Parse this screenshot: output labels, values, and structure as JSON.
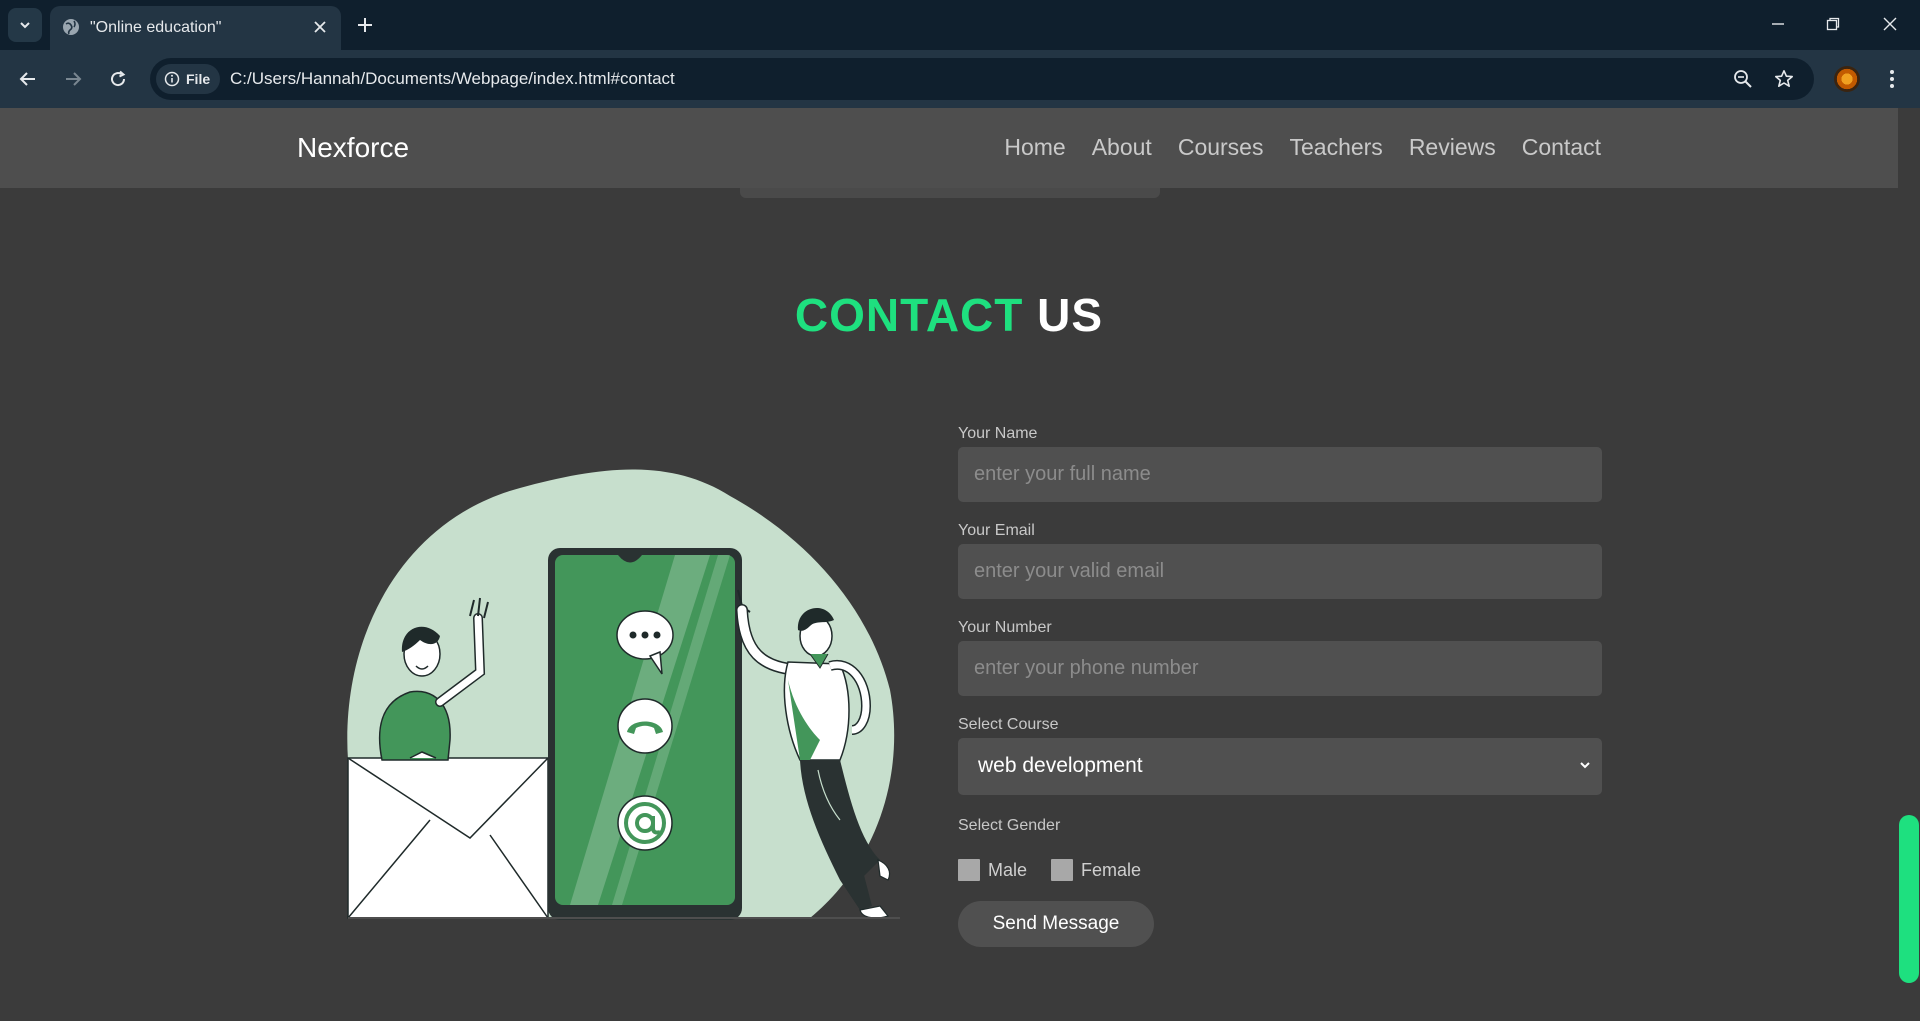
{
  "browser": {
    "tab_title": "\"Online education\"",
    "site_chip_label": "File",
    "url": "C:/Users/Hannah/Documents/Webpage/index.html#contact"
  },
  "site": {
    "logo": "Nexforce",
    "nav": [
      "Home",
      "About",
      "Courses",
      "Teachers",
      "Reviews",
      "Contact"
    ]
  },
  "contact": {
    "heading_accent": "CONTACT",
    "heading_rest": "US",
    "name_label": "Your Name",
    "name_placeholder": "enter your full name",
    "email_label": "Your Email",
    "email_placeholder": "enter your valid email",
    "number_label": "Your Number",
    "number_placeholder": "enter your phone number",
    "course_label": "Select Course",
    "course_selected": "web development",
    "gender_label": "Select Gender",
    "gender_options": [
      "Male",
      "Female"
    ],
    "send_label": "Send Message"
  },
  "colors": {
    "accent": "#1ee07f",
    "page_bg": "#3b3b3b",
    "header_bg": "#4e4e4e",
    "input_bg": "#505050",
    "illustration_green": "#43965a",
    "illustration_mint": "#c7dfcd"
  },
  "icons": [
    "chevron-down-icon",
    "globe-icon",
    "close-icon",
    "plus-icon",
    "minimize-icon",
    "restore-icon",
    "back-arrow-icon",
    "forward-arrow-icon",
    "reload-icon",
    "info-icon",
    "zoom-icon",
    "star-icon",
    "kebab-menu-icon"
  ]
}
